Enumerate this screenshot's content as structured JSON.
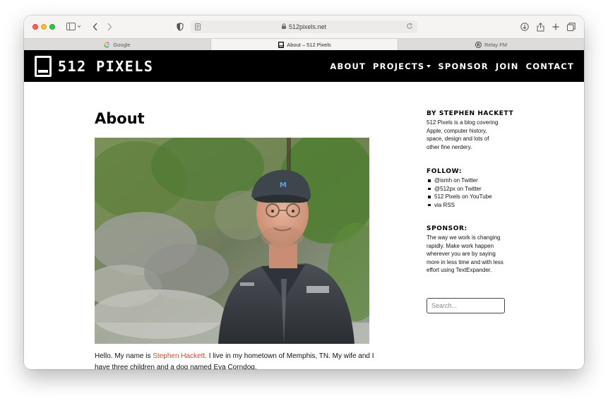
{
  "browser": {
    "url": "512pixels.net",
    "tabs": [
      {
        "label": "Google",
        "icon": "google-favicon"
      },
      {
        "label": "About – 512 Pixels",
        "icon": "512pixels-favicon"
      },
      {
        "label": "Relay FM",
        "icon": "relayfm-favicon"
      }
    ]
  },
  "site": {
    "logo_text": "512 PIXELS",
    "nav": [
      "ABOUT",
      "PROJECTS",
      "SPONSOR",
      "JOIN",
      "CONTACT"
    ]
  },
  "page": {
    "title": "About",
    "intro_before": "Hello. My name is ",
    "intro_link": "Stephen Hackett.",
    "intro_after": " I live in my hometown of Memphis, TN. My wife and I have three children and a dog named Eva Corndog."
  },
  "sidebar": {
    "by_heading": "BY STEPHEN HACKETT",
    "by_text": "512 Pixels is a blog covering Apple, computer history, space, design and lots of other fine nerdery.",
    "follow_heading": "FOLLOW:",
    "follow_items": [
      "@ismh on Twitter",
      "@512px on Twitter",
      "512 Pixels on YouTube",
      "via RSS"
    ],
    "sponsor_heading": "SPONSOR:",
    "sponsor_text": "The way we work is changing rapidly. Make work happen wherever you are by saying more in less time and with less effort using TextExpander.",
    "search_placeholder": "Search..."
  },
  "colors": {
    "link": "#e0452d",
    "header_bg": "#000000"
  }
}
